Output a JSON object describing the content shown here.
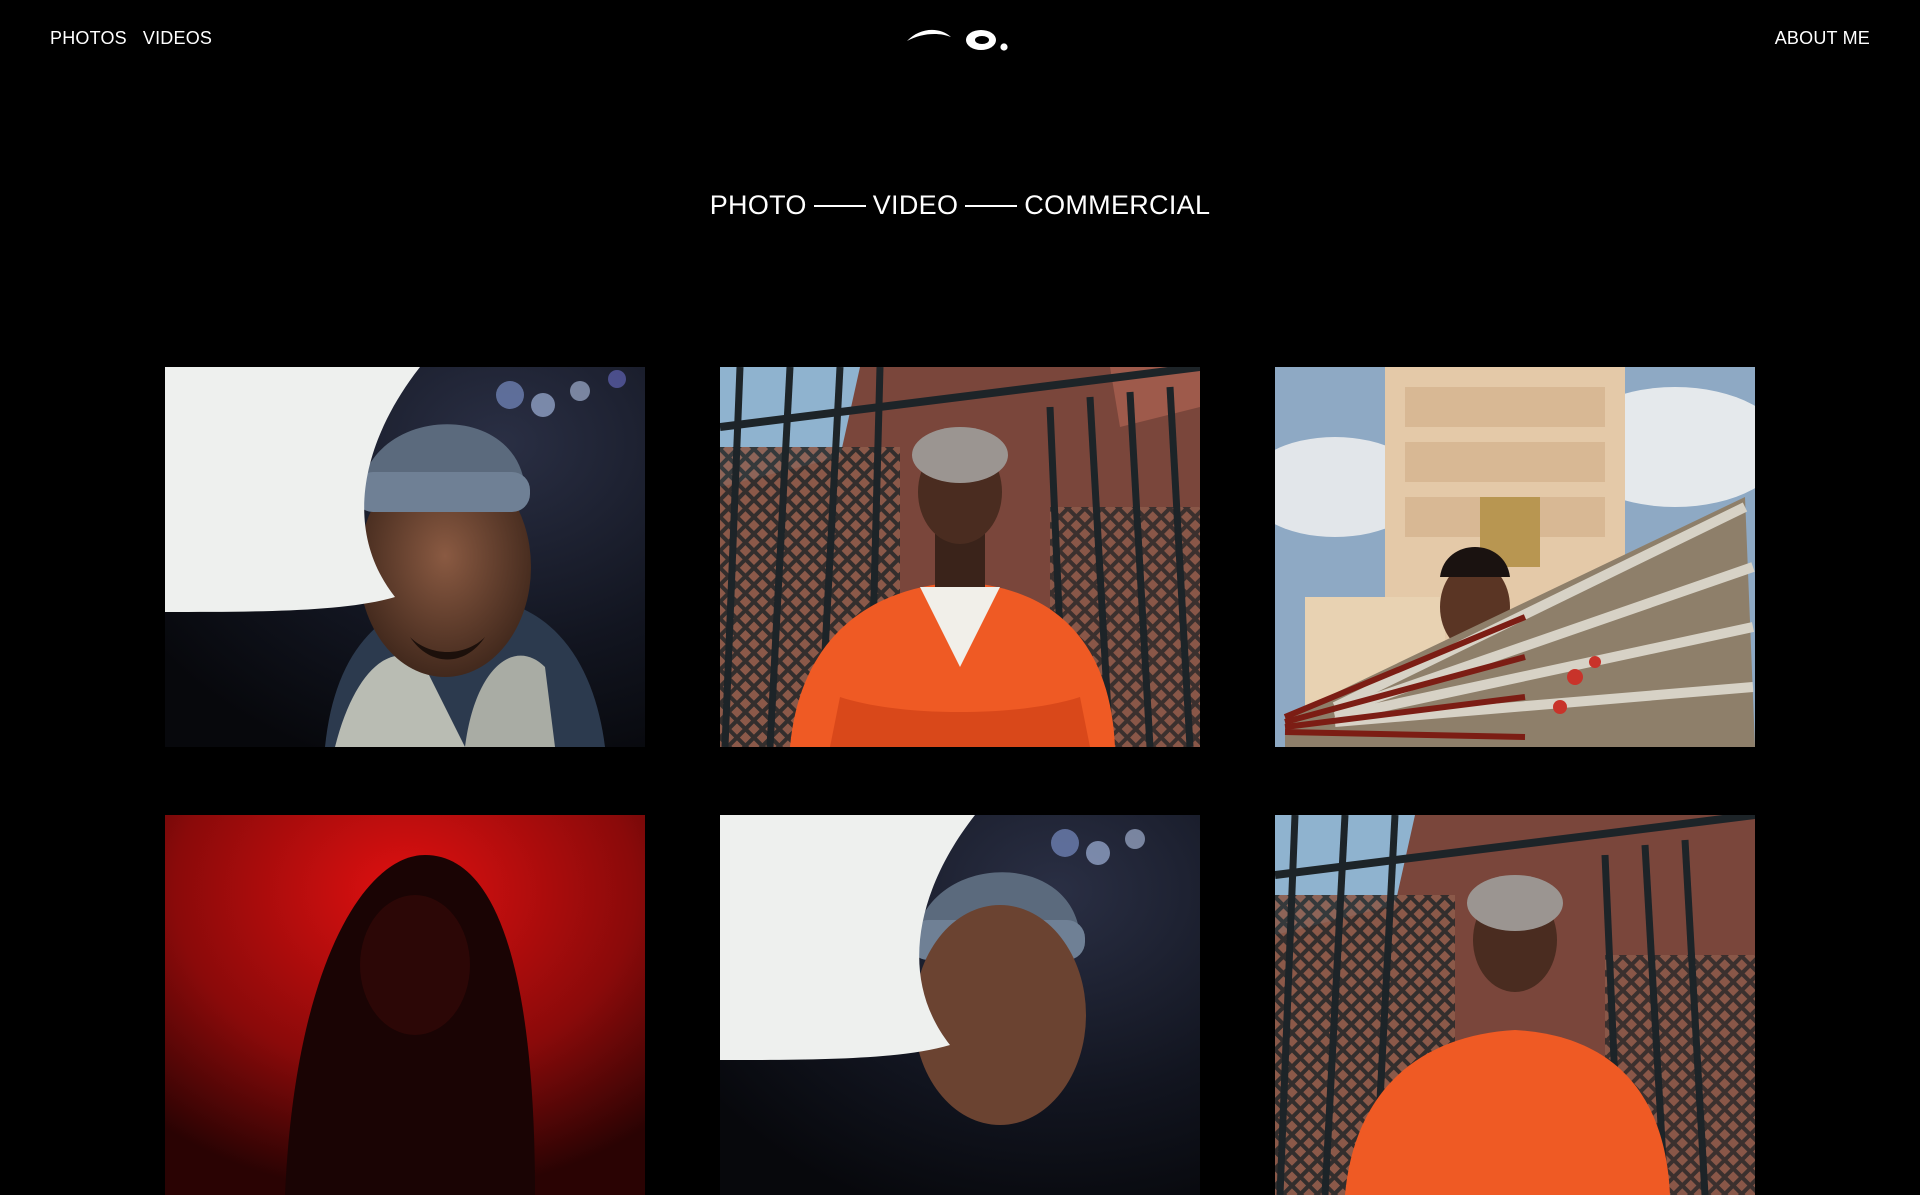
{
  "nav": {
    "left_items": [
      {
        "label": "PHOTOS"
      },
      {
        "label": "VIDEOS"
      }
    ],
    "right_item": {
      "label": "ABOUT ME"
    }
  },
  "logo": {
    "icon": "eye-logo-icon"
  },
  "tagline": {
    "parts": [
      "PHOTO",
      "VIDEO",
      "COMMERCIAL"
    ]
  },
  "gallery": {
    "tiles": [
      {
        "subject": "portrait-beanie-light"
      },
      {
        "subject": "portrait-orange-jacket-fence"
      },
      {
        "subject": "portrait-temple-fan"
      },
      {
        "subject": "portrait-red-hood"
      },
      {
        "subject": "portrait-beanie-light"
      },
      {
        "subject": "portrait-orange-jacket-fence"
      }
    ]
  },
  "colors": {
    "background": "#000000",
    "text": "#ffffff"
  }
}
